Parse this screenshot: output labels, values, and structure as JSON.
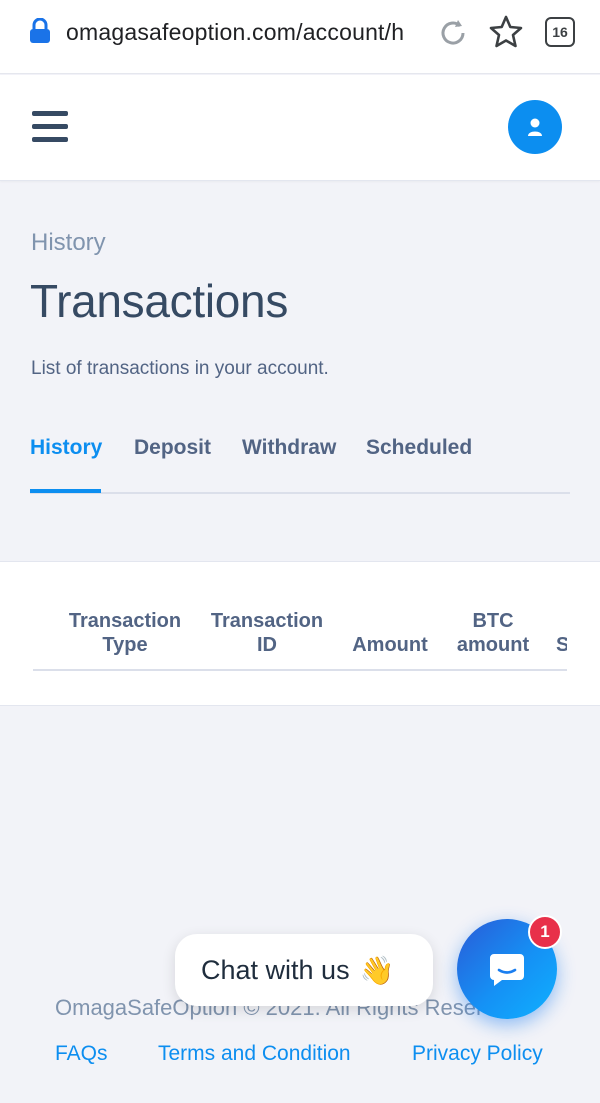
{
  "browser": {
    "url": "omagasafeoption.com/account/h",
    "tab_count": "16"
  },
  "page": {
    "breadcrumb": "History",
    "title": "Transactions",
    "subtitle": "List of transactions in your account."
  },
  "tabs": [
    {
      "label": "History",
      "active": true
    },
    {
      "label": "Deposit",
      "active": false
    },
    {
      "label": "Withdraw",
      "active": false
    },
    {
      "label": "Scheduled",
      "active": false
    }
  ],
  "table": {
    "columns": [
      {
        "line1": "Transaction",
        "line2": "Type"
      },
      {
        "line1": "Transaction",
        "line2": "ID"
      },
      {
        "line1": "",
        "line2": "Amount"
      },
      {
        "line1": "BTC",
        "line2": "amount"
      },
      {
        "line1": "",
        "line2": "S"
      }
    ]
  },
  "footer": {
    "copyright": "OmagaSafeOption © 2021. All Rights Reserved.",
    "links": [
      "FAQs",
      "Terms and Condition",
      "Privacy Policy"
    ]
  },
  "chat": {
    "prompt": "Chat with us",
    "emoji": "👋",
    "badge_count": "1"
  },
  "colors": {
    "accent": "#0c8ef0",
    "text": "#364a63",
    "muted": "#8094ae",
    "background": "#f2f3f8",
    "badge": "#e8304a"
  },
  "icons": [
    "lock-icon",
    "reload-icon",
    "star-icon",
    "hamburger-menu-icon",
    "user-icon",
    "chat-icon"
  ]
}
